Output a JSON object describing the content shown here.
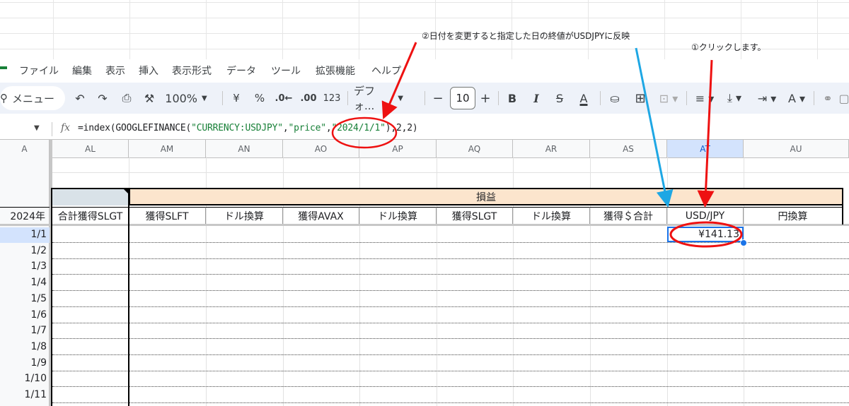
{
  "annotations": {
    "note_2": "②日付を変更すると指定した日の終値がUSDJPYに反映",
    "note_1": "①クリックします。"
  },
  "menu": [
    "ファイル",
    "編集",
    "表示",
    "挿入",
    "表示形式",
    "データ",
    "ツール",
    "拡張機能",
    "ヘルプ"
  ],
  "toolbar": {
    "menu_search": "メニュー",
    "zoom": "100%",
    "currency": "¥",
    "percent": "%",
    "dec_decrease": ".0←",
    "dec_increase": ".00",
    "number_format": "123",
    "font": "デフォ...",
    "minus": "−",
    "font_size": "10",
    "plus": "+",
    "bold": "B",
    "italic": "I",
    "strike": "S",
    "text_color": "A"
  },
  "formula_bar": {
    "fx": "fx",
    "part1": "=index(GOOGLEFINANCE(",
    "arg1": "\"CURRENCY:USDJPY\"",
    "comma1": ",",
    "arg2": "\"price\"",
    "comma2": ",",
    "arg3": "\"2024/1/1\"",
    "tail": "),2,2)"
  },
  "columns": [
    "A",
    "AL",
    "AM",
    "AN",
    "AO",
    "AP",
    "AQ",
    "AR",
    "AS",
    "AT",
    "AU"
  ],
  "table": {
    "group_header": "損益",
    "year_label": "2024年",
    "headers": [
      "合計獲得SLGT",
      "獲得SLFT",
      "ドル換算",
      "獲得AVAX",
      "ドル換算",
      "獲得SLGT",
      "ドル換算",
      "獲得＄合計",
      "USD/JPY",
      "円換算"
    ],
    "row_dates": [
      "1/1",
      "1/2",
      "1/3",
      "1/4",
      "1/5",
      "1/6",
      "1/7",
      "1/8",
      "1/9",
      "1/10",
      "1/11"
    ],
    "usdjpy_value": "¥141.13"
  },
  "colors": {
    "group_header_bg": "#fce5cd",
    "blank_header_bg": "#d9e2e8",
    "selected_blue": "#1a73e8",
    "annotation_red": "#ee1111",
    "annotation_cyan": "#1ea7e4"
  }
}
